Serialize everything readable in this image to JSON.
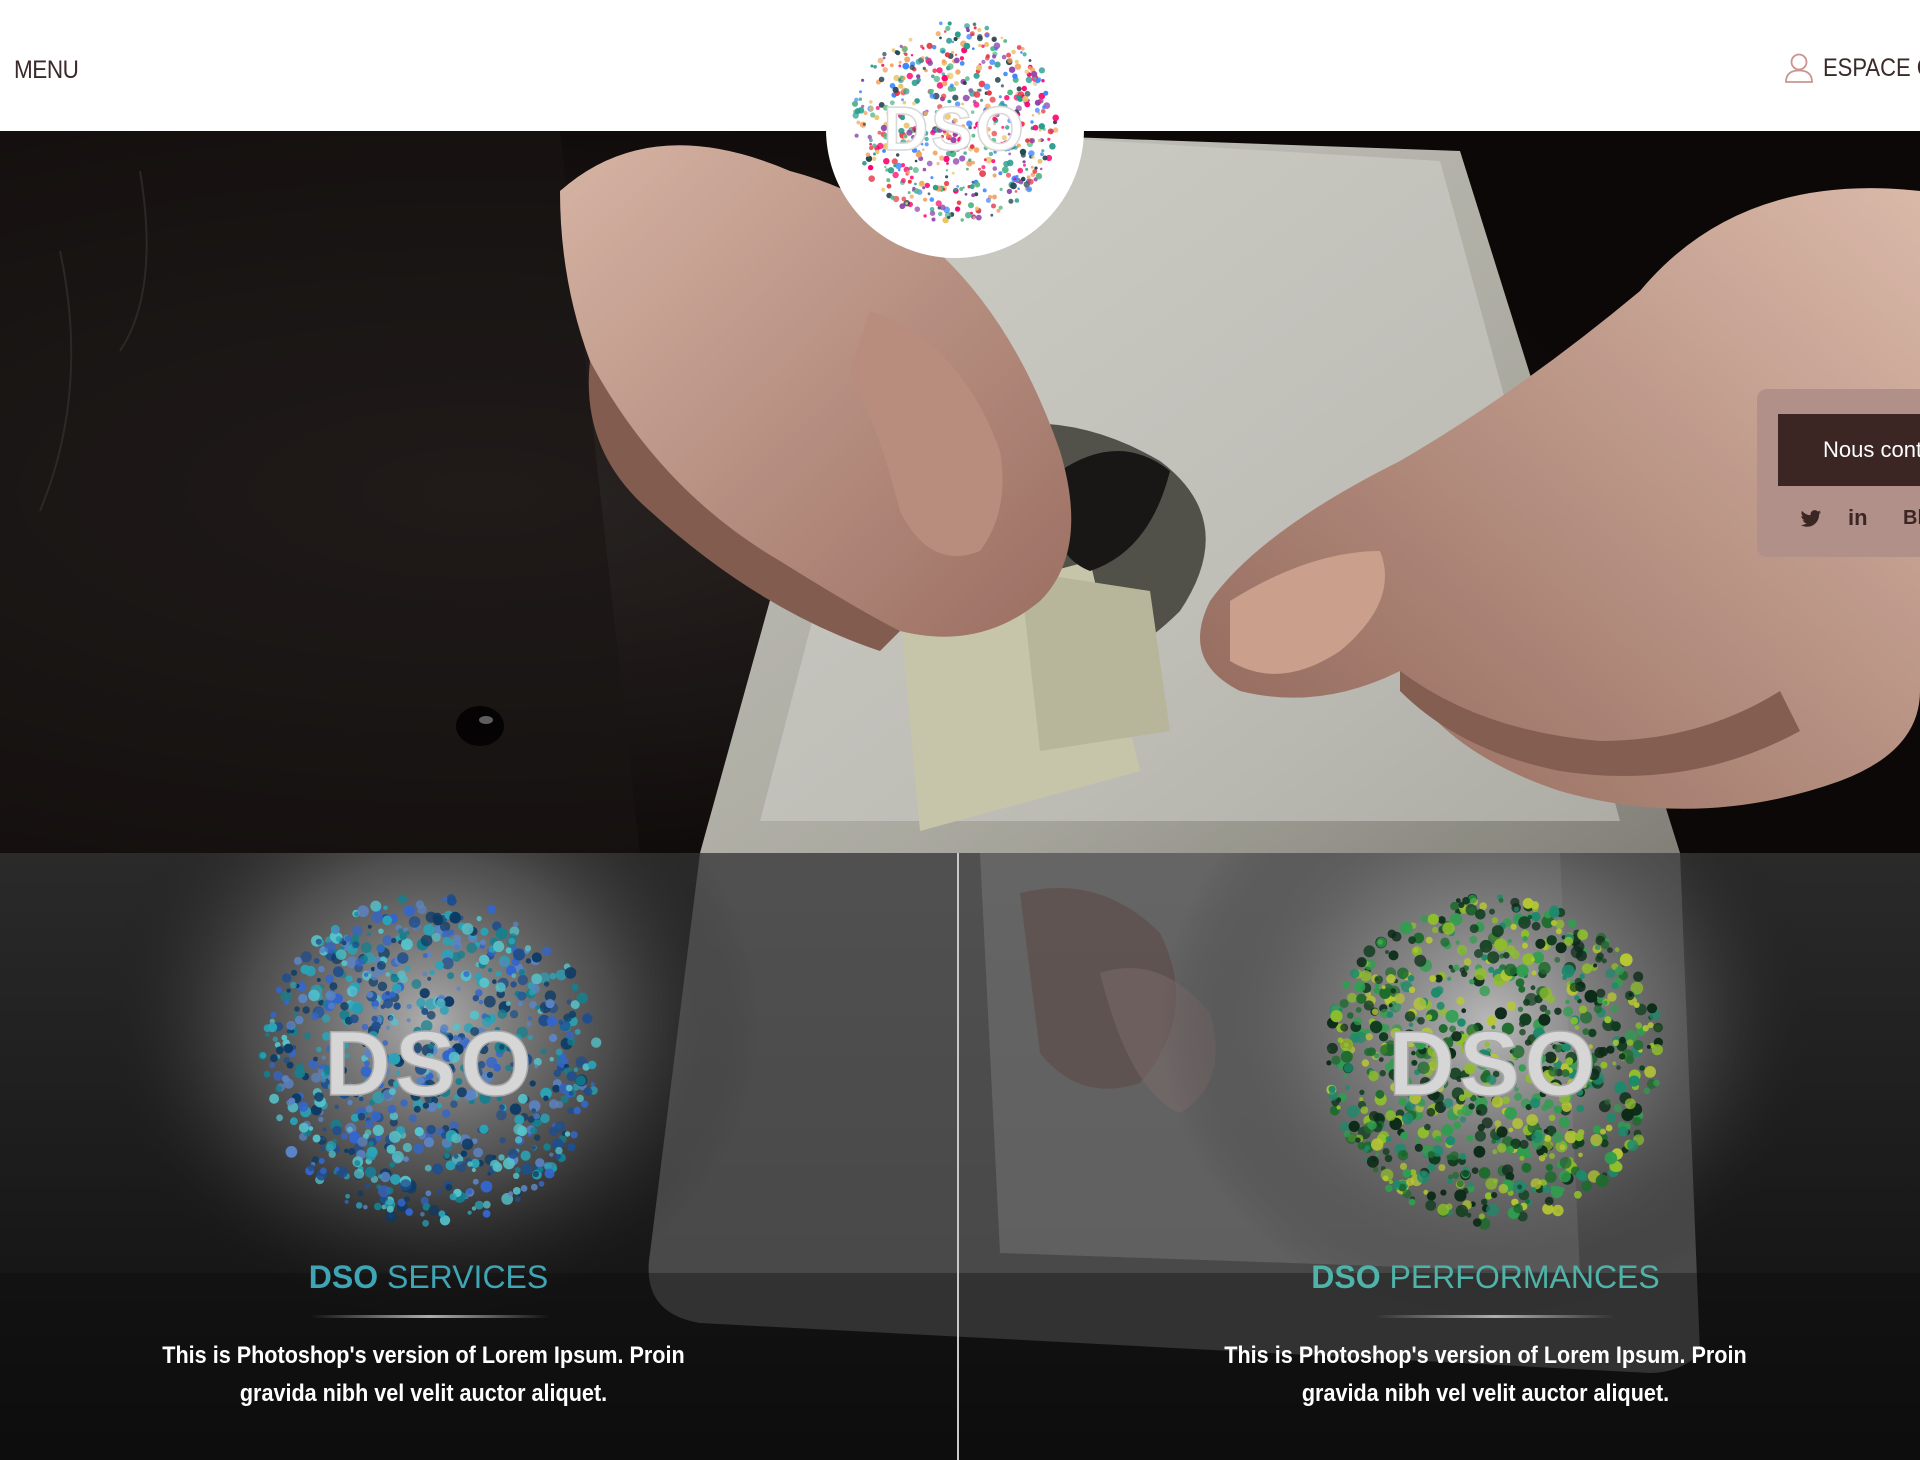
{
  "header": {
    "menu_label": "MENU",
    "client_label": "ESPACE CLIENT",
    "user_icon": "user-icon"
  },
  "logo": {
    "text": "DSO"
  },
  "contact": {
    "button_label": "Nous contacter",
    "social": [
      {
        "icon": "twitter-icon",
        "label": "t"
      },
      {
        "icon": "linkedin-icon",
        "label": "in"
      },
      {
        "icon": "blog-link",
        "label": "Blog"
      }
    ]
  },
  "services": [
    {
      "logo_text": "DSO",
      "title_brand": "DSO",
      "title_suffix": " SERVICES",
      "description_line1": "This is Photoshop's version  of Lorem Ipsum. Proin",
      "description_line2": "gravida nibh vel velit auctor aliquet.",
      "accent_color": "#3fa5b5",
      "dot_palette": [
        "#1f4e8c",
        "#2aa3b7",
        "#3366cc",
        "#14808f",
        "#5b84c4",
        "#0d3b66",
        "#56c2c9"
      ]
    },
    {
      "logo_text": "DSO",
      "title_brand": "DSO",
      "title_suffix": " PERFORMANCES",
      "description_line1": "This is Photoshop's version  of Lorem Ipsum. Proin",
      "description_line2": "gravida nibh vel velit auctor aliquet.",
      "accent_color": "#4fb3a9",
      "dot_palette": [
        "#1e6b2e",
        "#8fbf2a",
        "#1d8a6b",
        "#0f3d1e",
        "#b7c832",
        "#2f9e4f",
        "#0c2a18"
      ]
    }
  ],
  "colors": {
    "header_bg": "#ffffff",
    "header_text": "#3a2a28",
    "contact_panel": "#b09088",
    "contact_button": "#3b2624",
    "logo_palette": [
      "#e63946",
      "#f4a261",
      "#2a9d8f",
      "#264653",
      "#e9c46a",
      "#8e44ad",
      "#3a86ff",
      "#ff006e",
      "#52b788"
    ]
  }
}
